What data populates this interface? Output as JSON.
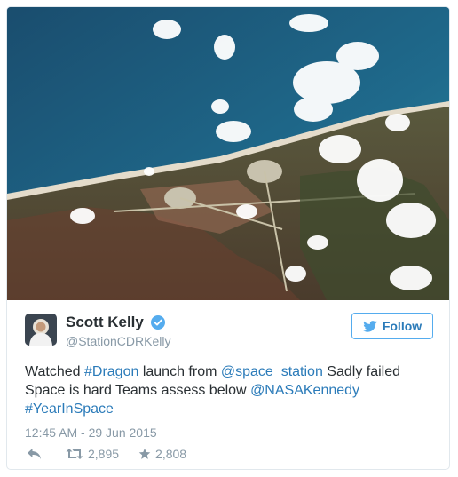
{
  "tweet": {
    "author": {
      "display_name": "Scott Kelly",
      "handle": "@StationCDRKelly",
      "verified": true
    },
    "follow_label": "Follow",
    "text_segments": [
      {
        "text": "Watched ",
        "link": false
      },
      {
        "text": "#Dragon",
        "link": true
      },
      {
        "text": " launch from ",
        "link": false
      },
      {
        "text": "@space_station",
        "link": true
      },
      {
        "text": " Sadly failed Space is hard Teams assess below ",
        "link": false
      },
      {
        "text": "@NASAKennedy",
        "link": true
      },
      {
        "text": " ",
        "link": false
      },
      {
        "text": "#YearInSpace",
        "link": true
      }
    ],
    "timestamp": "12:45 AM - 29 Jun 2015",
    "retweets": "2,895",
    "likes": "2,808"
  },
  "icons": {
    "verified": "verified-badge-icon",
    "follow": "twitter-bird-icon",
    "reply": "reply-icon",
    "retweet": "retweet-icon",
    "like": "star-icon"
  },
  "colors": {
    "accent": "#55acee",
    "link": "#2b7bb9",
    "muted": "#8899a6",
    "text": "#292f33"
  }
}
